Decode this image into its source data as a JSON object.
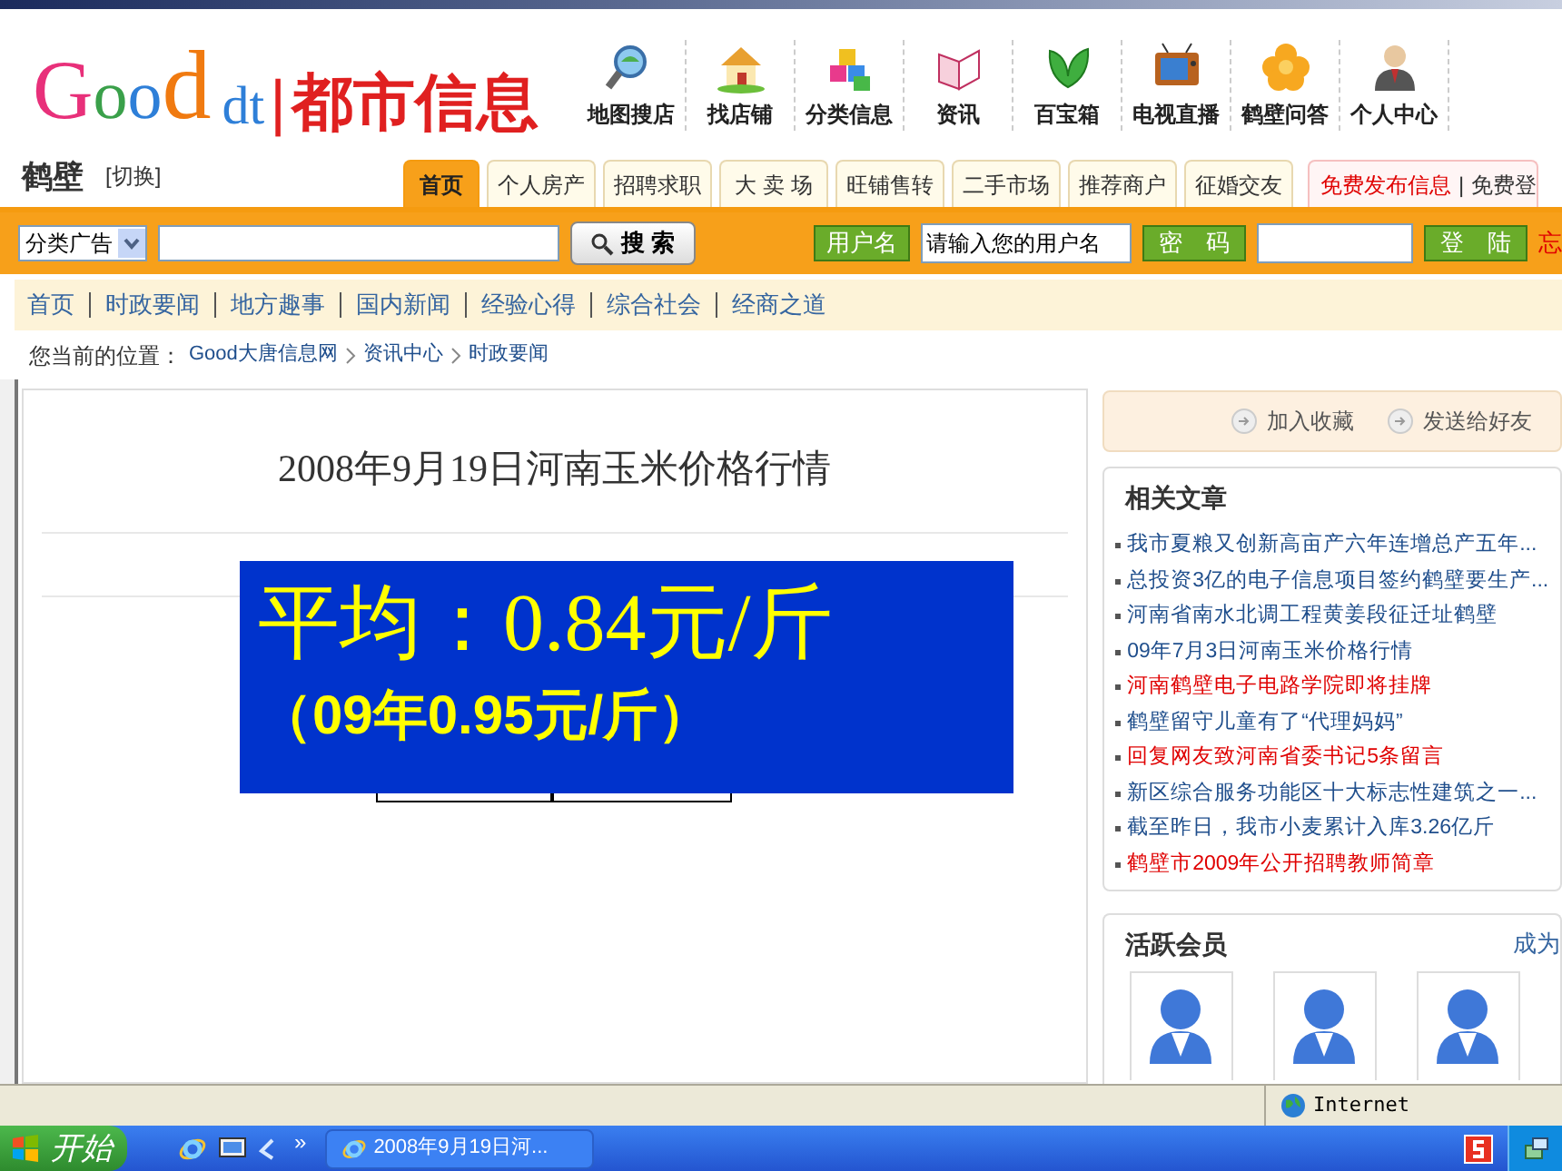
{
  "header": {
    "logo": {
      "brand": "Good",
      "suffix": "dt",
      "divider": "|",
      "name": "都市信息"
    },
    "nav": [
      {
        "kind": "magnifier",
        "label": "地图搜店"
      },
      {
        "kind": "house",
        "label": "找店铺"
      },
      {
        "kind": "blocks",
        "label": "分类信息"
      },
      {
        "kind": "book",
        "label": "资讯"
      },
      {
        "kind": "leaf",
        "label": "百宝箱"
      },
      {
        "kind": "tv",
        "label": "电视直播"
      },
      {
        "kind": "flower",
        "label": "鹤壁问答"
      },
      {
        "kind": "person",
        "label": "个人中心"
      }
    ]
  },
  "city": {
    "name": "鹤壁",
    "switch": "[切换]"
  },
  "tabs": [
    {
      "label": "首页",
      "selected": true
    },
    {
      "label": "个人房产",
      "selected": false
    },
    {
      "label": "招聘求职",
      "selected": false
    },
    {
      "label": "大 卖 场",
      "selected": false
    },
    {
      "label": "旺铺售转",
      "selected": false
    },
    {
      "label": "二手市场",
      "selected": false
    },
    {
      "label": "推荐商户",
      "selected": false
    },
    {
      "label": "征婚交友",
      "selected": false
    }
  ],
  "top_links": {
    "publish": "免费发布信息",
    "separator": "|",
    "register": "免费登"
  },
  "search_bar": {
    "category": "分类广告",
    "search_button": "搜 索",
    "username_label": "用户名",
    "username_value": "请输入您的用户名",
    "password_label": "密　码",
    "login_button": "登　陆",
    "forgot": "忘"
  },
  "nav_links": [
    "首页",
    "时政要闻",
    "地方趣事",
    "国内新闻",
    "经验心得",
    "综合社会",
    "经商之道"
  ],
  "breadcrumb": {
    "label": "您当前的位置：",
    "items": [
      "Good大唐信息网",
      "资讯中心",
      "时政要闻"
    ]
  },
  "article": {
    "title": "2008年9月19日河南玉米价格行情"
  },
  "actions": [
    "加入收藏",
    "发送给好友"
  ],
  "related": {
    "title": "相关文章",
    "items": [
      {
        "text": "我市夏粮又创新高亩产六年连增总产五年...",
        "color": "#1f4e8c"
      },
      {
        "text": "总投资3亿的电子信息项目签约鹤壁要生产...",
        "color": "#1f4e8c"
      },
      {
        "text": "河南省南水北调工程黄姜段征迁址鹤壁",
        "color": "#1f4e8c"
      },
      {
        "text": "09年7月3日河南玉米价格行情",
        "color": "#1f4e8c"
      },
      {
        "text": "河南鹤壁电子电路学院即将挂牌",
        "color": "#e00000"
      },
      {
        "text": "鹤壁留守儿童有了“代理妈妈”",
        "color": "#1f4e8c"
      },
      {
        "text": "回复网友致河南省委书记5条留言",
        "color": "#e00000"
      },
      {
        "text": "新区综合服务功能区十大标志性建筑之一...",
        "color": "#1f4e8c"
      },
      {
        "text": "截至昨日，我市小麦累计入库3.26亿斤",
        "color": "#1f4e8c"
      },
      {
        "text": "鹤壁市2009年公开招聘教师简章",
        "color": "#e00000"
      }
    ]
  },
  "members": {
    "title": "活跃会员",
    "more": "成为"
  },
  "overlay": {
    "average": "平均：0.84元/斤",
    "previous": "（09年0.95元/斤）"
  },
  "status_bar": {
    "zone": "Internet"
  },
  "taskbar": {
    "start": "开始",
    "more": "»",
    "task": "2008年9月19日河..."
  }
}
